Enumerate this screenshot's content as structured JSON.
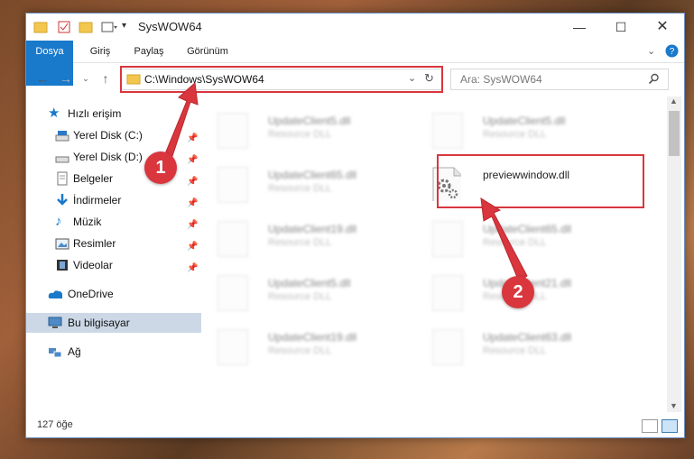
{
  "window": {
    "title": "SysWOW64"
  },
  "ribbon": {
    "tabs": [
      "Dosya",
      "Giriş",
      "Paylaş",
      "Görünüm"
    ]
  },
  "address": {
    "path": "C:\\Windows\\SysWOW64"
  },
  "search": {
    "placeholder": "Ara: SysWOW64"
  },
  "sidebar": {
    "quick_access": "Hızlı erişim",
    "items": [
      {
        "label": "Yerel Disk (C:)",
        "icon": "drive-icon"
      },
      {
        "label": "Yerel Disk (D:)",
        "icon": "drive-icon"
      },
      {
        "label": "Belgeler",
        "icon": "documents-icon"
      },
      {
        "label": "İndirmeler",
        "icon": "download-icon"
      },
      {
        "label": "Müzik",
        "icon": "music-icon"
      },
      {
        "label": "Resimler",
        "icon": "pictures-icon"
      },
      {
        "label": "Videolar",
        "icon": "video-icon"
      }
    ],
    "onedrive": "OneDrive",
    "this_pc": "Bu bilgisayar",
    "network": "Ağ"
  },
  "files": [
    {
      "name": "UpdateClient5.dll",
      "type": "Resource DLL"
    },
    {
      "name": "UpdateClient5.dll",
      "type": "Resource DLL"
    },
    {
      "name": "UpdateClient65.dll",
      "type": "Resource DLL"
    },
    {
      "name": "previewwindow.dll",
      "type": ""
    },
    {
      "name": "UpdateClient19.dll",
      "type": "Resource DLL"
    },
    {
      "name": "UpdateClient65.dll",
      "type": "Resource DLL"
    },
    {
      "name": "UpdateClient5.dll",
      "type": "Resource DLL"
    },
    {
      "name": "UpdateClient21.dll",
      "type": "Resource DLL"
    },
    {
      "name": "UpdateClient19.dll",
      "type": "Resource DLL"
    },
    {
      "name": "UpdateClient63.dll",
      "type": "Resource DLL"
    }
  ],
  "status": {
    "count": "127 öğe"
  },
  "annotations": {
    "step1": "1",
    "step2": "2",
    "color": "#d9363e"
  }
}
